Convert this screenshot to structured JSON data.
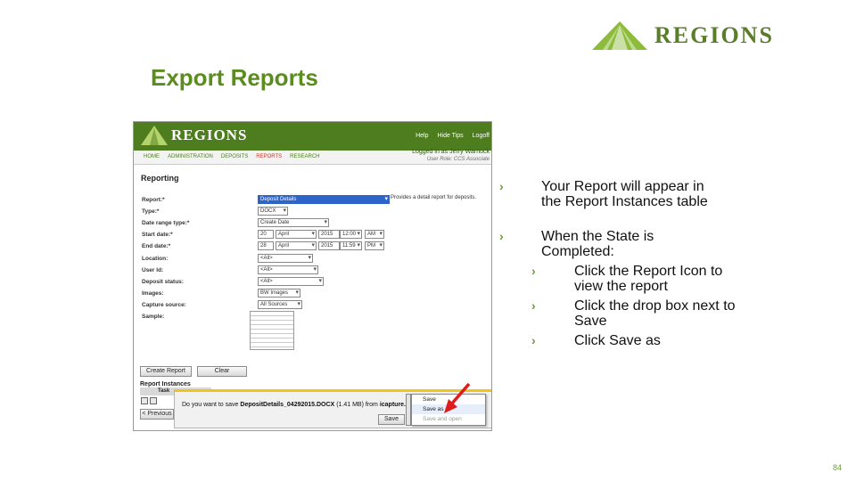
{
  "brand": {
    "name": "REGIONS",
    "accent": "#5b8c1e",
    "logo_green": "#8dbb3a"
  },
  "slide": {
    "title": "Export Reports",
    "page_number": "84"
  },
  "bullets": [
    {
      "text": "Your Report will appear in the Report Instances table",
      "level": 1
    },
    {
      "text": "When the State is Completed:",
      "level": 1
    },
    {
      "text": "Click the Report Icon to view the report",
      "level": 2
    },
    {
      "text": "Click the drop box next to Save",
      "level": 2
    },
    {
      "text": "Click Save as",
      "level": 2
    }
  ],
  "app": {
    "logo_text": "REGIONS",
    "header_links": [
      "Help",
      "Hide Tips",
      "Logoff"
    ],
    "nav_tabs": [
      "HOME",
      "ADMINISTRATION",
      "DEPOSITS",
      "REPORTS",
      "RESEARCH"
    ],
    "active_tab": "REPORTS",
    "user": {
      "logged_in": "Logged in as Jerry Warnock",
      "role": "User Role: CCS Associate"
    },
    "page_title": "Reporting",
    "form": {
      "report_label": "Report:*",
      "report_value": "Deposit Details",
      "report_description": "Provides a detail report for deposits.",
      "type_label": "Type:*",
      "type_value": "DOCX",
      "date_range_label": "Date range type:*",
      "date_range_value": "Create Date",
      "start_label": "Start date:*",
      "start_day": "20",
      "start_month": "April",
      "start_year": "2015",
      "start_time": "12:00",
      "start_ampm": "AM",
      "end_label": "End date:*",
      "end_day": "28",
      "end_month": "April",
      "end_year": "2015",
      "end_time": "11:59",
      "end_ampm": "PM",
      "location_label": "Location:",
      "location_value": "<All>",
      "userid_label": "User Id:",
      "userid_value": "<All>",
      "deposit_status_label": "Deposit status:",
      "deposit_status_value": "<All>",
      "images_label": "Images:",
      "images_value": "BW Images",
      "capture_label": "Capture source:",
      "capture_value": "All Sources",
      "sample_label": "Sample:"
    },
    "buttons": {
      "create_report": "Create Report",
      "clear": "Clear",
      "previous": "< Previous"
    },
    "instances": {
      "title": "Report Instances",
      "col_task": "Task"
    },
    "download": {
      "prompt_prefix": "Do you want to save",
      "filename": "DepositDetails_04292015.DOCX",
      "size": "(1.41 MB) from",
      "source": "icapture.regi",
      "save_label": "Save",
      "menu": [
        "Save",
        "Save as",
        "Save and open"
      ]
    }
  }
}
